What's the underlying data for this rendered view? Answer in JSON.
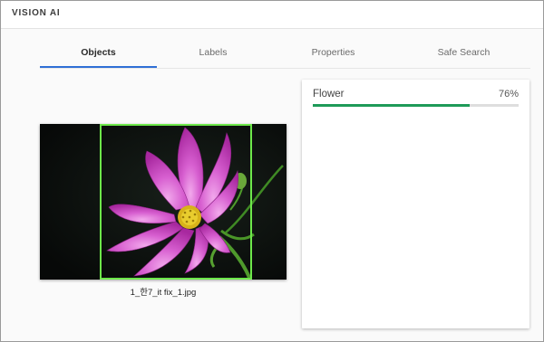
{
  "app": {
    "title": "VISION AI"
  },
  "tabs": [
    {
      "label": "Objects",
      "active": true
    },
    {
      "label": "Labels",
      "active": false
    },
    {
      "label": "Properties",
      "active": false
    },
    {
      "label": "Safe Search",
      "active": false
    }
  ],
  "image": {
    "filename": "1_한7_it fix_1.jpg",
    "bbox_color": "#6de84a"
  },
  "results": [
    {
      "label": "Flower",
      "score_text": "76%",
      "score": 0.76
    }
  ],
  "colors": {
    "accent": "#2f6fd6",
    "bar_fill": "#1e9a58",
    "bar_track": "#dedede"
  }
}
